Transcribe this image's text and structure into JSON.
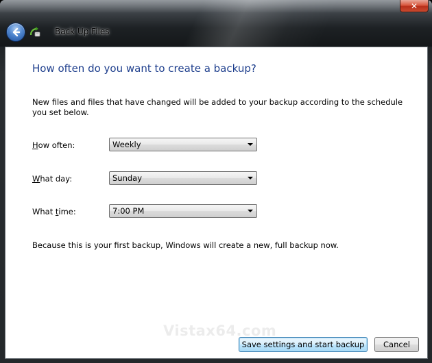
{
  "window": {
    "title": "Back Up Files",
    "close_glyph": "✕",
    "back_icon": "back-arrow-icon",
    "app_icon": "backup-files-icon"
  },
  "page": {
    "heading": "How often do you want to create a backup?",
    "description": "New files and files that have changed will be added to your backup according to the schedule you set below."
  },
  "fields": {
    "how_often": {
      "label_accel": "H",
      "label_rest": "ow often:",
      "value": "Weekly"
    },
    "what_day": {
      "label_accel": "W",
      "label_rest": "hat day:",
      "value": "Sunday"
    },
    "what_time": {
      "label_pre": "What ",
      "label_accel": "t",
      "label_rest": "ime:",
      "value": "7:00 PM"
    }
  },
  "note": "Because this is your first backup, Windows will create a new, full backup now.",
  "watermark": "Vistax64.com",
  "buttons": {
    "save_label": "Save settings and start backup",
    "cancel_label": "Cancel"
  },
  "colors": {
    "heading": "#1c3d8c",
    "close_button": "#c94a2f",
    "default_button_border": "#3c7fb1"
  }
}
